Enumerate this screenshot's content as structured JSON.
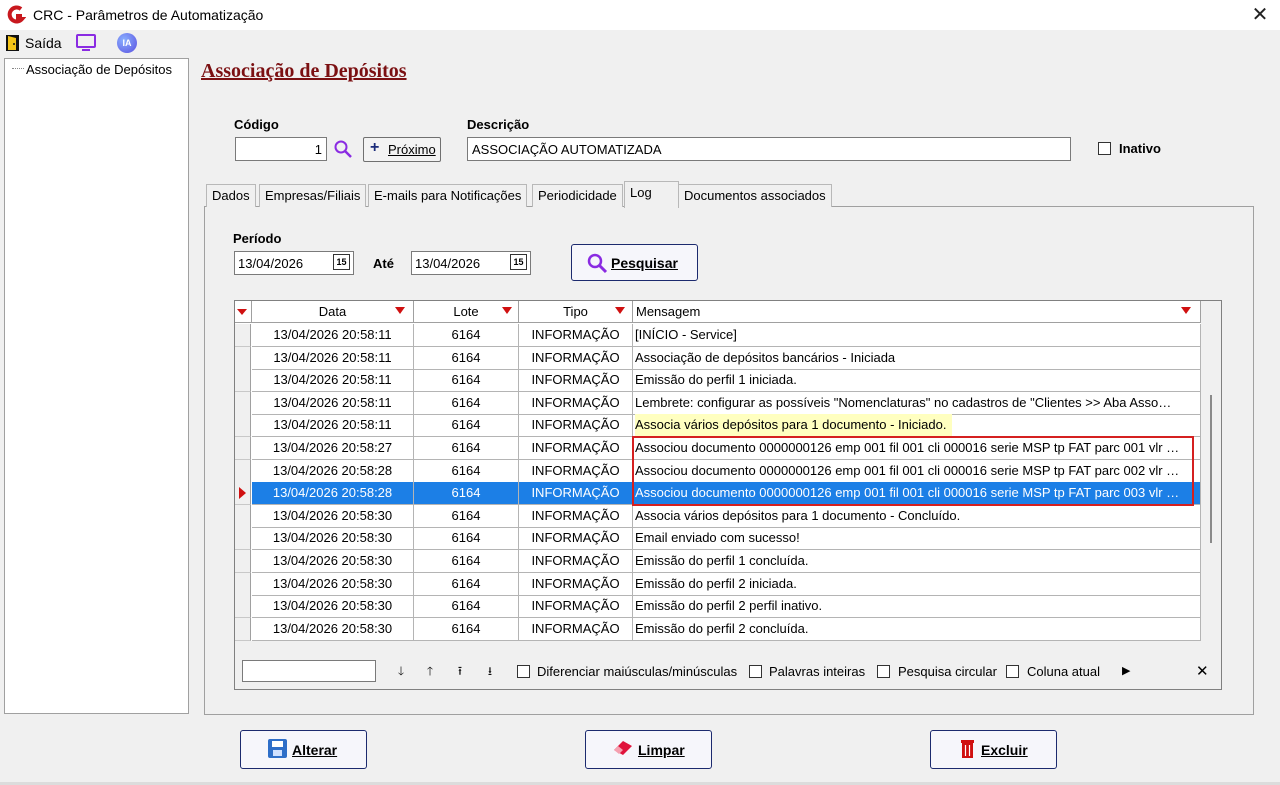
{
  "window": {
    "title": "CRC - Parâmetros de Automatização",
    "close_glyph": "✕"
  },
  "toolbar": {
    "exit_label": "Saída",
    "ia_label": "IA"
  },
  "tree": {
    "items": [
      "Associação de Depósitos"
    ]
  },
  "page": {
    "title": "Associação de Depósitos"
  },
  "form": {
    "codigo_label": "Código",
    "codigo_value": "1",
    "next_button_label": "Próximo",
    "next_button_icon": "+",
    "descricao_label": "Descrição",
    "descricao_value": "ASSOCIAÇÃO AUTOMATIZADA",
    "inativo_label": "Inativo"
  },
  "tabs": [
    {
      "label": "Dados"
    },
    {
      "label": "Empresas/Filiais"
    },
    {
      "label": "E-mails para Notificações"
    },
    {
      "label": "Periodicidade"
    },
    {
      "label": "Log",
      "active": true
    },
    {
      "label": "Documentos associados"
    }
  ],
  "log": {
    "periodo_label": "Período",
    "date_from": "13/04/2026",
    "ate_label": "Até",
    "date_to": "13/04/2026",
    "calendar_icon_text": "15",
    "search_button_label": "Pesquisar",
    "columns": [
      "Data",
      "Lote",
      "Tipo",
      "Mensagem"
    ],
    "rows": [
      {
        "data": "13/04/2026 20:58:11",
        "lote": "6164",
        "tipo": "INFORMAÇÃO",
        "mensagem": "[INÍCIO - Service]"
      },
      {
        "data": "13/04/2026 20:58:11",
        "lote": "6164",
        "tipo": "INFORMAÇÃO",
        "mensagem": "Associação de depósitos bancários - Iniciada"
      },
      {
        "data": "13/04/2026 20:58:11",
        "lote": "6164",
        "tipo": "INFORMAÇÃO",
        "mensagem": "Emissão do perfil 1 iniciada."
      },
      {
        "data": "13/04/2026 20:58:11",
        "lote": "6164",
        "tipo": "INFORMAÇÃO",
        "mensagem": "Lembrete: configurar as possíveis \"Nomenclaturas\" no cadastros de \"Clientes >> Aba Asso…"
      },
      {
        "data": "13/04/2026 20:58:11",
        "lote": "6164",
        "tipo": "INFORMAÇÃO",
        "mensagem": "Associa vários depósitos para 1 documento - Iniciado."
      },
      {
        "data": "13/04/2026 20:58:27",
        "lote": "6164",
        "tipo": "INFORMAÇÃO",
        "mensagem": "Associou documento 0000000126 emp 001 fil 001 cli 000016 serie MSP tp FAT parc 001 vlr …"
      },
      {
        "data": "13/04/2026 20:58:28",
        "lote": "6164",
        "tipo": "INFORMAÇÃO",
        "mensagem": "Associou documento 0000000126 emp 001 fil 001 cli 000016 serie MSP tp FAT parc 002 vlr …"
      },
      {
        "data": "13/04/2026 20:58:28",
        "lote": "6164",
        "tipo": "INFORMAÇÃO",
        "mensagem": "Associou documento 0000000126 emp 001 fil 001 cli 000016 serie MSP tp FAT parc 003 vlr …"
      },
      {
        "data": "13/04/2026 20:58:30",
        "lote": "6164",
        "tipo": "INFORMAÇÃO",
        "mensagem": "Associa vários depósitos para 1 documento - Concluído."
      },
      {
        "data": "13/04/2026 20:58:30",
        "lote": "6164",
        "tipo": "INFORMAÇÃO",
        "mensagem": "Email enviado com sucesso!"
      },
      {
        "data": "13/04/2026 20:58:30",
        "lote": "6164",
        "tipo": "INFORMAÇÃO",
        "mensagem": "Emissão do perfil 1 concluída."
      },
      {
        "data": "13/04/2026 20:58:30",
        "lote": "6164",
        "tipo": "INFORMAÇÃO",
        "mensagem": "Emissão do perfil 2 iniciada."
      },
      {
        "data": "13/04/2026 20:58:30",
        "lote": "6164",
        "tipo": "INFORMAÇÃO",
        "mensagem": "Emissão do perfil 2 perfil inativo."
      },
      {
        "data": "13/04/2026 20:58:30",
        "lote": "6164",
        "tipo": "INFORMAÇÃO",
        "mensagem": "Emissão do perfil 2 concluída."
      }
    ],
    "selected_row_index": 7,
    "highlighted_row_index": 4,
    "find_bar": {
      "options": [
        "Diferenciar maiúsculas/minúsculas",
        "Palavras inteiras",
        "Pesquisa circular",
        "Coluna atual"
      ],
      "nav_glyphs": [
        "🡓",
        "🡑",
        "⭱",
        "⭳"
      ],
      "more_glyph": "▶",
      "close_glyph": "✕"
    }
  },
  "actions": {
    "alterar_label": "Alterar",
    "limpar_label": "Limpar",
    "excluir_label": "Excluir"
  },
  "colors": {
    "title_red": "#7b1012",
    "selection_blue": "#1c7fe6",
    "highlight_frame_red": "#d52020",
    "tooltip_yellow": "#ffffc0"
  }
}
